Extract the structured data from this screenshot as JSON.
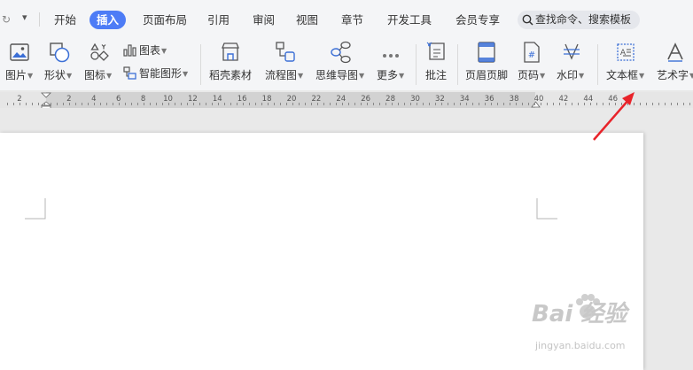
{
  "menubar": {
    "tabs": [
      {
        "label": "开始"
      },
      {
        "label": "插入",
        "active": true
      },
      {
        "label": "页面布局"
      },
      {
        "label": "引用"
      },
      {
        "label": "审阅"
      },
      {
        "label": "视图"
      },
      {
        "label": "章节"
      },
      {
        "label": "开发工具"
      },
      {
        "label": "会员专享"
      }
    ],
    "search_placeholder": "查找命令、搜索模板"
  },
  "ribbon": {
    "picture": "图片",
    "shape": "形状",
    "icon": "图标",
    "chart": "图表",
    "smart_graphic": "智能图形",
    "material": "稻壳素材",
    "flowchart": "流程图",
    "mindmap": "思维导图",
    "more": "更多",
    "comment": "批注",
    "header_footer": "页眉页脚",
    "page_number": "页码",
    "watermark": "水印",
    "textbox": "文本框",
    "wordart": "艺术字"
  },
  "ruler": {
    "numbers": [
      "2",
      "2",
      "4",
      "6",
      "8",
      "10",
      "12",
      "14",
      "16",
      "18",
      "20",
      "22",
      "24",
      "26",
      "28",
      "30",
      "32",
      "34",
      "36",
      "38",
      "40",
      "42",
      "44",
      "46"
    ]
  },
  "watermark": {
    "brand": "Bai 经验",
    "url": "jingyan.baidu.com"
  },
  "colors": {
    "accent": "#4d7cf6",
    "arrow": "#e8232a",
    "icon_blue": "#3b6fd6"
  }
}
